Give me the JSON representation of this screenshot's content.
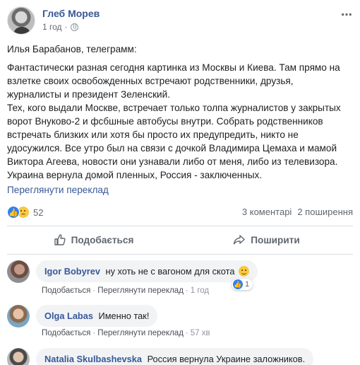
{
  "post": {
    "author": "Глеб Морев",
    "time": "1 год",
    "separator": "·",
    "more_icon": "⋯",
    "lead": "Илья Барабанов, телеграмм:",
    "lines": [
      "Фантастически разная сегодня картинка из Москвы и Киева. Там прямо на",
      "взлетке своих освобожденных встречают родственники, друзья,",
      "журналисты и президент Зеленский.",
      "Тех, кого выдали Москве, встречает только толпа журналистов у закрытых",
      "ворот Внуково-2 и фсбшные автобусы внутри. Собрать родственников",
      "встречать близких или хотя бы просто их предупредить, никто не",
      "удосужился. Все утро был на связи с дочкой Владимира Цемаха и мамой",
      "Виктора Агеева, новости они узнавали либо от меня, либо из телевизора.",
      "Украина вернула домой пленных, Россия - заключенных."
    ],
    "translate": "Переглянути переклад"
  },
  "reactions": {
    "count": "52",
    "comments": "3 коментарі",
    "shares": "2 поширення"
  },
  "actions": {
    "like": "Подобається",
    "share": "Поширити"
  },
  "comments": [
    {
      "name": "Igor Bobyrev",
      "text": "ну хоть не с вагоном для скота",
      "like": "Подобається",
      "translate": "Переглянути переклад",
      "time": "1 год",
      "reaction_count": "1"
    },
    {
      "name": "Olga Labas",
      "text": "Именно так!",
      "like": "Подобається",
      "translate": "Переглянути переклад",
      "time": "57 хв"
    },
    {
      "name": "Natalia Skulbashevska",
      "text": "Россия вернула Украине заложников."
    }
  ],
  "colors": {
    "link": "#385898",
    "like_blue": "#2e81f4",
    "bubble": "#f2f3f5"
  }
}
